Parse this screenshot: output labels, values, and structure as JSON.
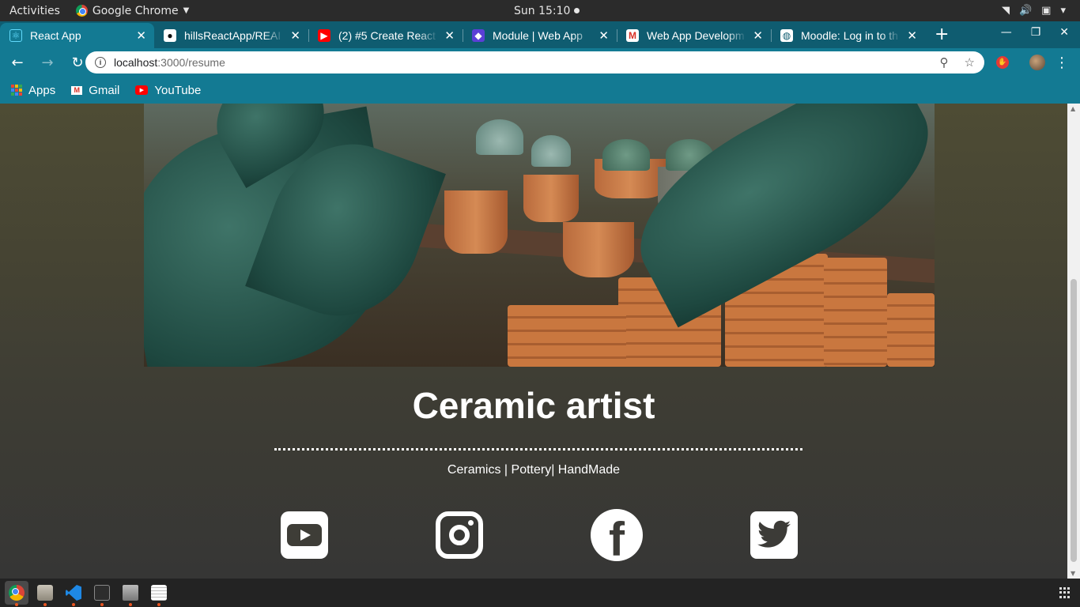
{
  "system_bar": {
    "activities": "Activities",
    "app_name": "Google Chrome",
    "clock": "Sun 15:10"
  },
  "tabs": [
    {
      "label": "React App",
      "icon": "react-icon",
      "active": true
    },
    {
      "label": "hillsReactApp/REAI",
      "icon": "github-icon"
    },
    {
      "label": "(2) #5 Create React",
      "icon": "youtube-icon"
    },
    {
      "label": "Module | Web App",
      "icon": "module-icon"
    },
    {
      "label": "Web App Developm",
      "icon": "gmail-icon"
    },
    {
      "label": "Moodle: Log in to th",
      "icon": "globe-icon"
    }
  ],
  "address_bar": {
    "host": "localhost",
    "path": ":3000/resume"
  },
  "bookmarks": [
    {
      "label": "Apps",
      "icon": "apps-grid-icon"
    },
    {
      "label": "Gmail",
      "icon": "gmail-icon"
    },
    {
      "label": "YouTube",
      "icon": "youtube-icon"
    }
  ],
  "page": {
    "title": "Ceramic artist",
    "subtitle": "Ceramics | Pottery| HandMade",
    "social_links": [
      {
        "name": "YouTube",
        "icon": "youtube-icon"
      },
      {
        "name": "Instagram",
        "icon": "instagram-icon"
      },
      {
        "name": "Facebook",
        "icon": "facebook-icon"
      },
      {
        "name": "Twitter",
        "icon": "twitter-icon"
      }
    ]
  },
  "theme": {
    "chrome_frame": "#0f5c70",
    "chrome_toolbar": "#137a93",
    "page_bg_top": "#4e4c34",
    "page_bg_bottom": "#363635"
  }
}
